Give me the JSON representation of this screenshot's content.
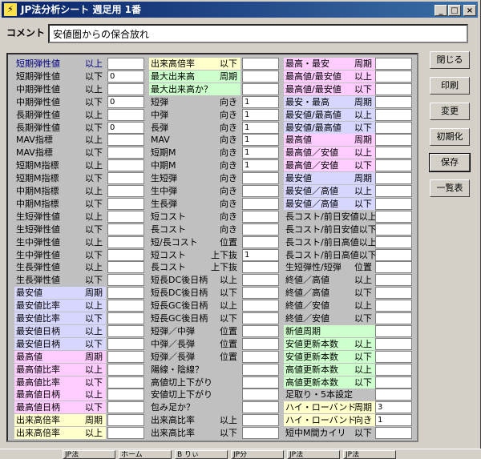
{
  "window": {
    "title": "JP法分析シート  週足用  1番",
    "icon_name": "lightning-icon",
    "min": "_",
    "max": "□",
    "close": "×"
  },
  "comment": {
    "label": "コメント",
    "value": "安値圏からの保合放れ"
  },
  "col1": [
    {
      "label": "短期弾性値",
      "cond": "以上",
      "value": "",
      "bg": "",
      "navy": true
    },
    {
      "label": "短期弾性値",
      "cond": "以下",
      "value": "0",
      "bg": ""
    },
    {
      "label": "中期弾性値",
      "cond": "以上",
      "value": "",
      "bg": ""
    },
    {
      "label": "中期弾性値",
      "cond": "以下",
      "value": "0",
      "bg": ""
    },
    {
      "label": "長期弾性値",
      "cond": "以上",
      "value": "",
      "bg": ""
    },
    {
      "label": "長期弾性値",
      "cond": "以下",
      "value": "0",
      "bg": ""
    },
    {
      "label": "MAV指標",
      "cond": "以上",
      "value": "",
      "bg": ""
    },
    {
      "label": "MAV指標",
      "cond": "以下",
      "value": "",
      "bg": ""
    },
    {
      "label": "短期M指標",
      "cond": "以上",
      "value": "",
      "bg": ""
    },
    {
      "label": "短期M指標",
      "cond": "以下",
      "value": "",
      "bg": ""
    },
    {
      "label": "中期M指標",
      "cond": "以上",
      "value": "",
      "bg": ""
    },
    {
      "label": "中期M指標",
      "cond": "以下",
      "value": "",
      "bg": ""
    },
    {
      "label": "生短弾性値",
      "cond": "以上",
      "value": "",
      "bg": ""
    },
    {
      "label": "生短弾性値",
      "cond": "以下",
      "value": "",
      "bg": ""
    },
    {
      "label": "生中弾性値",
      "cond": "以上",
      "value": "",
      "bg": ""
    },
    {
      "label": "生中弾性値",
      "cond": "以下",
      "value": "",
      "bg": ""
    },
    {
      "label": "生長弾性値",
      "cond": "以上",
      "value": "",
      "bg": ""
    },
    {
      "label": "生長弾性値",
      "cond": "以下",
      "value": "",
      "bg": ""
    },
    {
      "label": "最安値",
      "cond": "周期",
      "value": "",
      "bg": "b"
    },
    {
      "label": "最安値比率",
      "cond": "以上",
      "value": "",
      "bg": "b"
    },
    {
      "label": "最安値比率",
      "cond": "以下",
      "value": "",
      "bg": "b"
    },
    {
      "label": "最安値日柄",
      "cond": "以上",
      "value": "",
      "bg": "b"
    },
    {
      "label": "最安値日柄",
      "cond": "以下",
      "value": "",
      "bg": "b"
    },
    {
      "label": "最高値",
      "cond": "周期",
      "value": "",
      "bg": "p"
    },
    {
      "label": "最高値比率",
      "cond": "以上",
      "value": "",
      "bg": "p"
    },
    {
      "label": "最高値比率",
      "cond": "以下",
      "value": "",
      "bg": "p"
    },
    {
      "label": "最高値日柄",
      "cond": "以上",
      "value": "",
      "bg": "p"
    },
    {
      "label": "最高値日柄",
      "cond": "以下",
      "value": "",
      "bg": "p"
    },
    {
      "label": "出来高倍率",
      "cond": "周期",
      "value": "",
      "bg": "y"
    },
    {
      "label": "出来高倍率",
      "cond": "以上",
      "value": "",
      "bg": "y"
    }
  ],
  "col2": [
    {
      "label": "出来高倍率",
      "cond": "以下",
      "value": "",
      "bg": "y"
    },
    {
      "label": "最大出来高",
      "cond": "周期",
      "value": "",
      "bg": "g"
    },
    {
      "label": "最大出来高か？",
      "cond": "",
      "value": "",
      "bg": "g"
    },
    {
      "label": "短弾",
      "cond": "向き",
      "value": "1",
      "bg": ""
    },
    {
      "label": "中弾",
      "cond": "向き",
      "value": "1",
      "bg": ""
    },
    {
      "label": "長弾",
      "cond": "向き",
      "value": "1",
      "bg": ""
    },
    {
      "label": "MAV",
      "cond": "向き",
      "value": "1",
      "bg": ""
    },
    {
      "label": "短期M",
      "cond": "向き",
      "value": "1",
      "bg": ""
    },
    {
      "label": "中期M",
      "cond": "向き",
      "value": "1",
      "bg": ""
    },
    {
      "label": "生短弾",
      "cond": "向き",
      "value": "",
      "bg": ""
    },
    {
      "label": "生中弾",
      "cond": "向き",
      "value": "",
      "bg": ""
    },
    {
      "label": "生長弾",
      "cond": "向き",
      "value": "",
      "bg": ""
    },
    {
      "label": "短コスト",
      "cond": "向き",
      "value": "",
      "bg": ""
    },
    {
      "label": "長コスト",
      "cond": "向き",
      "value": "",
      "bg": ""
    },
    {
      "label": "短/長コスト",
      "cond": "位置",
      "value": "",
      "bg": ""
    },
    {
      "label": "短コスト",
      "cond": "上下抜",
      "value": "1",
      "bg": ""
    },
    {
      "label": "長コスト",
      "cond": "上下抜",
      "value": "",
      "bg": ""
    },
    {
      "label": "短長DC後日柄",
      "cond": "以上",
      "value": "",
      "bg": ""
    },
    {
      "label": "短長DC後日柄",
      "cond": "以下",
      "value": "",
      "bg": ""
    },
    {
      "label": "短長GC後日柄",
      "cond": "以上",
      "value": "",
      "bg": ""
    },
    {
      "label": "短長GC後日柄",
      "cond": "以下",
      "value": "",
      "bg": ""
    },
    {
      "label": "短弾／中弾",
      "cond": "位置",
      "value": "",
      "bg": ""
    },
    {
      "label": "中弾／長弾",
      "cond": "位置",
      "value": "",
      "bg": ""
    },
    {
      "label": "短弾／長弾",
      "cond": "位置",
      "value": "",
      "bg": ""
    },
    {
      "label": "陽線・陰線？",
      "cond": "",
      "value": "",
      "bg": ""
    },
    {
      "label": "高値切上下がり",
      "cond": "",
      "value": "",
      "bg": ""
    },
    {
      "label": "安値切上下がり",
      "cond": "",
      "value": "",
      "bg": ""
    },
    {
      "label": "包み足か？",
      "cond": "",
      "value": "",
      "bg": ""
    },
    {
      "label": "出来高比率",
      "cond": "以上",
      "value": "",
      "bg": ""
    },
    {
      "label": "出来高比率",
      "cond": "以下",
      "value": "",
      "bg": ""
    }
  ],
  "col3": [
    {
      "label": "最高・最安",
      "cond": "周期",
      "value": "",
      "bg": "p"
    },
    {
      "label": "最高値/最安値",
      "cond": "以上",
      "value": "",
      "bg": "p"
    },
    {
      "label": "最高値/最安値",
      "cond": "以下",
      "value": "",
      "bg": "p"
    },
    {
      "label": "最安・最高",
      "cond": "周期",
      "value": "",
      "bg": "b"
    },
    {
      "label": "最安値/最高値",
      "cond": "以上",
      "value": "",
      "bg": "b"
    },
    {
      "label": "最安値/最高値",
      "cond": "以下",
      "value": "",
      "bg": "b"
    },
    {
      "label": "最高値",
      "cond": "周期",
      "value": "",
      "bg": "p"
    },
    {
      "label": "最高値／安値",
      "cond": "以上",
      "value": "",
      "bg": "p"
    },
    {
      "label": "最高値／安値",
      "cond": "以下",
      "value": "",
      "bg": "p"
    },
    {
      "label": "最安値",
      "cond": "周期",
      "value": "",
      "bg": "b"
    },
    {
      "label": "最安値／高値",
      "cond": "以上",
      "value": "",
      "bg": "b"
    },
    {
      "label": "最安値／高値",
      "cond": "以下",
      "value": "",
      "bg": "b"
    },
    {
      "label": "長コスト/前日安値以上",
      "cond": "",
      "value": "",
      "bg": ""
    },
    {
      "label": "長コスト/前日安値以下",
      "cond": "",
      "value": "",
      "bg": ""
    },
    {
      "label": "長コスト/前日高値以上",
      "cond": "",
      "value": "",
      "bg": ""
    },
    {
      "label": "長コスト/前日高値以下",
      "cond": "",
      "value": "",
      "bg": ""
    },
    {
      "label": "生短弾性/短弾",
      "cond": "位置",
      "value": "",
      "bg": ""
    },
    {
      "label": "終値／高値",
      "cond": "以上",
      "value": "",
      "bg": ""
    },
    {
      "label": "終値／高値",
      "cond": "以下",
      "value": "",
      "bg": ""
    },
    {
      "label": "終値／安値",
      "cond": "以上",
      "value": "",
      "bg": ""
    },
    {
      "label": "終値／安値",
      "cond": "以下",
      "value": "",
      "bg": ""
    },
    {
      "label": "新値周期",
      "cond": "",
      "value": "",
      "bg": "g"
    },
    {
      "label": "安値更新本数",
      "cond": "以上",
      "value": "",
      "bg": "g"
    },
    {
      "label": "安値更新本数",
      "cond": "以下",
      "value": "",
      "bg": "g"
    },
    {
      "label": "高値更新本数",
      "cond": "以上",
      "value": "",
      "bg": "g"
    },
    {
      "label": "高値更新本数",
      "cond": "以下",
      "value": "",
      "bg": "g"
    },
    {
      "label": "足取り・5本設定",
      "cond": "",
      "value": "",
      "bg": ""
    },
    {
      "label": "ハイ・ローバンド",
      "cond": "周期",
      "value": "3",
      "bg": "y"
    },
    {
      "label": "ハイ・ローバンド",
      "cond": "向き",
      "value": "1",
      "bg": "y"
    },
    {
      "label": "短中M間カイリ",
      "cond": "以下",
      "value": "",
      "bg": ""
    }
  ],
  "side_buttons": [
    "閉じる",
    "印刷",
    "変更",
    "初期化",
    "保存",
    "一覧表"
  ],
  "taskbar": [
    "JP法",
    "ホーム",
    "B りぃ",
    "JP分",
    "JP法",
    "JP法"
  ]
}
